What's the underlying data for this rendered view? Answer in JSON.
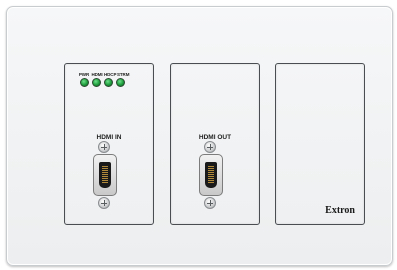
{
  "device": {
    "brand": "Extron",
    "leds": [
      {
        "label": "PWR"
      },
      {
        "label": "HDMI"
      },
      {
        "label": "HDCP"
      },
      {
        "label": "STRM"
      }
    ],
    "input_label": "HDMI IN",
    "output_label": "HDMI OUT"
  }
}
